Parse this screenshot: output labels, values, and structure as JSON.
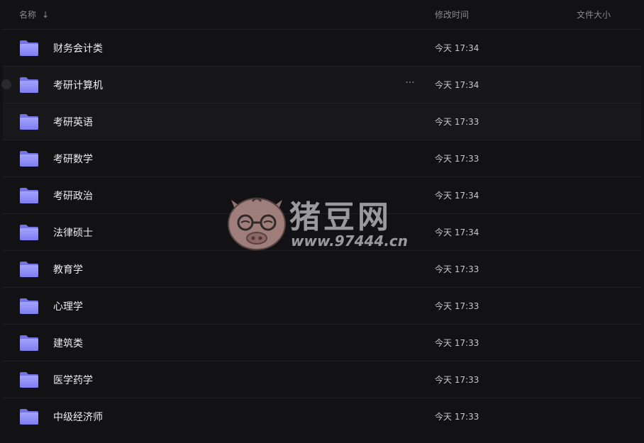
{
  "header": {
    "name_label": "名称",
    "sort_indicator": "↓",
    "time_label": "修改时间",
    "size_label": "文件大小"
  },
  "colors": {
    "background": "#121214",
    "folder_icon": "#8c8cf5",
    "text_primary": "#eeeef0",
    "text_secondary": "#8a8a90"
  },
  "rows": [
    {
      "name": "财务会计类",
      "time": "今天 17:34",
      "icon": "folder-icon"
    },
    {
      "name": "考研计算机",
      "time": "今天 17:34",
      "icon": "folder-icon",
      "more": "···"
    },
    {
      "name": "考研英语",
      "time": "今天 17:33",
      "icon": "folder-icon"
    },
    {
      "name": "考研数学",
      "time": "今天 17:33",
      "icon": "folder-icon"
    },
    {
      "name": "考研政治",
      "time": "今天 17:34",
      "icon": "folder-icon"
    },
    {
      "name": "法律硕士",
      "time": "今天 17:34",
      "icon": "folder-icon"
    },
    {
      "name": "教育学",
      "time": "今天 17:33",
      "icon": "folder-icon"
    },
    {
      "name": "心理学",
      "time": "今天 17:33",
      "icon": "folder-icon"
    },
    {
      "name": "建筑类",
      "time": "今天 17:33",
      "icon": "folder-icon"
    },
    {
      "name": "医学药学",
      "time": "今天 17:33",
      "icon": "folder-icon"
    },
    {
      "name": "中级经济师",
      "time": "今天 17:33",
      "icon": "folder-icon"
    }
  ],
  "watermark": {
    "title": "猪豆网",
    "url": "www.97444.cn"
  }
}
